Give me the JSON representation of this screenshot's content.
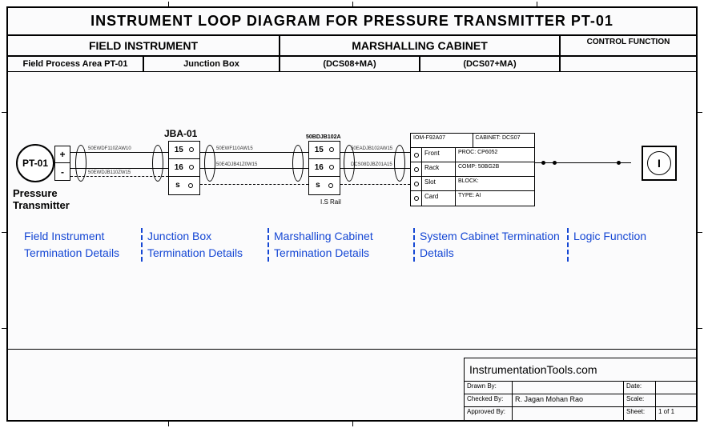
{
  "title": "INSTRUMENT LOOP DIAGRAM FOR PRESSURE TRANSMITTER PT-01",
  "headers": {
    "field": "FIELD INSTRUMENT",
    "marshalling": "MARSHALLING CABINET",
    "control": "CONTROL FUNCTION"
  },
  "subheaders": {
    "a": "Field Process Area PT-01",
    "b": "Junction Box",
    "c": "(DCS08+MA)",
    "d": "(DCS07+MA)",
    "e": ""
  },
  "transmitter": {
    "tag": "PT-01",
    "label": "Pressure\nTransmitter",
    "pos": "+",
    "neg": "-"
  },
  "junction_box": {
    "label": "JBA-01",
    "terminals": [
      "15",
      "16",
      "s"
    ]
  },
  "marshalling_box": {
    "label": "50BDJB102A",
    "terminals": [
      "15",
      "16",
      "s"
    ],
    "rail": "I.S Rail"
  },
  "system_cabinet": {
    "top": {
      "iom": "IOM-F92A07",
      "cabinet": "CABINET: DCS07"
    },
    "rows": [
      {
        "label": "Front",
        "value": "PROC: CP6052"
      },
      {
        "label": "Rack",
        "value": "COMP: 50BG2B"
      },
      {
        "label": "Slot",
        "value": "BLOCK:"
      },
      {
        "label": "Card",
        "value": "TYPE: AI"
      }
    ]
  },
  "logic": {
    "label": "I"
  },
  "blue_sections": {
    "a": "Field Instrument Termination Details",
    "b": "Junction Box Termination Details",
    "c": "Marshalling Cabinet Termination Details",
    "d": "System Cabinet Termination Details",
    "e": "Logic Function"
  },
  "titleblock": {
    "site": "InstrumentationTools.com",
    "rows": [
      {
        "l1": "Drawn By:",
        "l2": "",
        "l3": "Date:",
        "l4": ""
      },
      {
        "l1": "Checked By:",
        "l2": "R. Jagan Mohan Rao",
        "l3": "Scale:",
        "l4": ""
      },
      {
        "l1": "Approved By:",
        "l2": "",
        "l3": "Sheet:",
        "l4": "1 of 1"
      }
    ]
  },
  "wire_labels": {
    "w1": "50EWDF110ZAW10",
    "w2": "50EWDJB110ZW15",
    "w3": "50EWF110AW15",
    "w4": "50E4DJB41Z0W15",
    "w5": "50EADJB102AW15",
    "w6": "DCS08DJBZ01A15"
  }
}
